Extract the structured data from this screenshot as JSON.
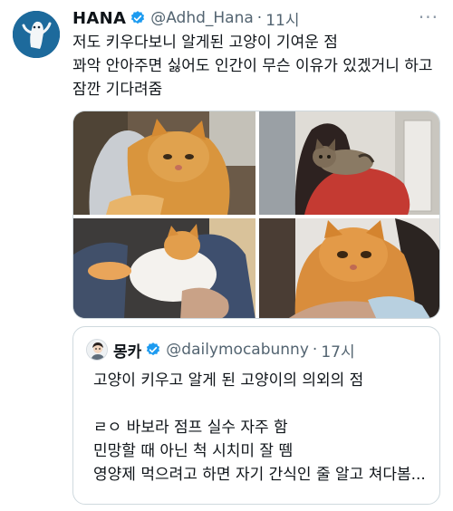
{
  "tweet": {
    "author_name": "HANA",
    "handle": "@Adhd_Hana",
    "separator": "·",
    "time": "11시",
    "more_label": "···",
    "text_lines": [
      "저도 키우다보니 알게된 고양이 기여운 점",
      "꽈악 안아주면 싫어도 인간이 무슨 이유가 있겠거니 하고",
      "잠깐 기다려줌"
    ],
    "verified_color": "#1d9bf0"
  },
  "quote": {
    "author_name": "몽카",
    "handle": "@dailymocabunny",
    "separator": "·",
    "time": "17시",
    "text_lines": [
      "고양이 키우고 알게 된 고양이의 의외의 점",
      "",
      "ㄹㅇ 바보라 점프 실수 자주 함",
      "민망할 때 아닌 척 시치미 잘 뗌",
      "영양제 먹으려고 하면 자기 간식인 줄 알고 쳐다봄..."
    ]
  },
  "media": [
    {
      "name": "orange-cat-hugged-photo"
    },
    {
      "name": "tabby-cat-hugged-photo"
    },
    {
      "name": "white-orange-cat-held-photo"
    },
    {
      "name": "orange-cat-held-close-photo"
    }
  ]
}
